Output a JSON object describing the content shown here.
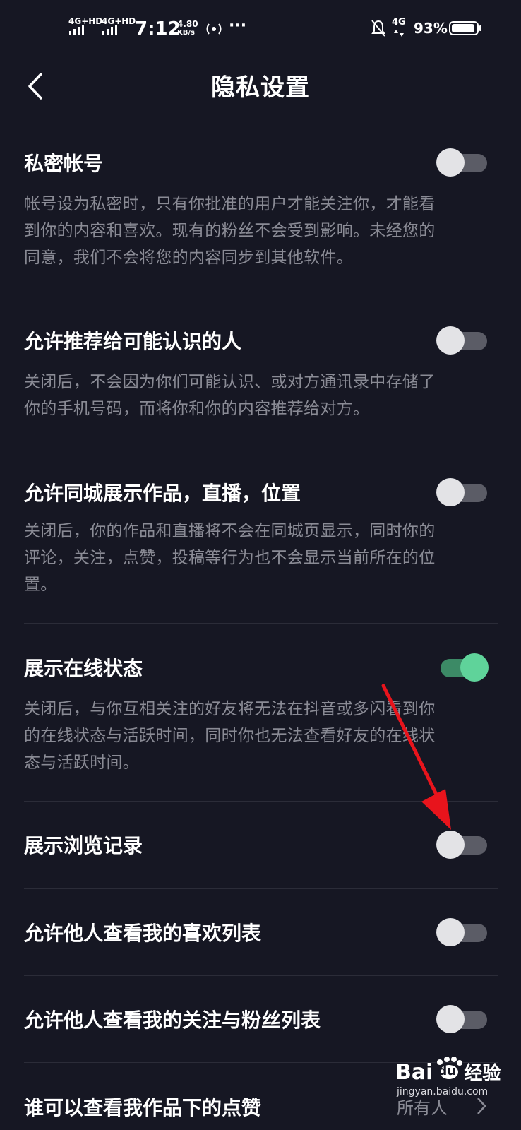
{
  "status_bar": {
    "net1": "4G+HD",
    "net2": "4G+HD",
    "time": "7:12",
    "speed_value": "4.80",
    "speed_unit": "KB/s",
    "dots": "···",
    "net3": "4G",
    "battery": "93%",
    "battery_level": 0.93
  },
  "header": {
    "title": "隐私设置",
    "back_icon": "chevron-left-icon"
  },
  "settings": [
    {
      "title": "私密帐号",
      "desc": [
        "帐号设为私密时，只有你批准的用户才能关注你，才能看",
        "到你的内容和喜欢。现有的粉丝不会受到影响。未经您的",
        "同意，我们不会将您的内容同步到其他软件。"
      ],
      "enabled": false
    },
    {
      "title": "允许推荐给可能认识的人",
      "desc": [
        "关闭后，不会因为你们可能认识、或对方通讯录中存储了",
        "你的手机号码，而将你和你的内容推荐给对方。"
      ],
      "enabled": false
    },
    {
      "title": "允许同城展示作品，直播，位置",
      "desc": [
        "关闭后，你的作品和直播将不会在同城页显示，同时你的",
        "评论，关注，点赞，投稿等行为也不会显示当前所在的位",
        "置。"
      ],
      "enabled": false
    },
    {
      "title": "展示在线状态",
      "desc": [
        "关闭后，与你互相关注的好友将无法在抖音或多闪看到你",
        "的在线状态与活跃时间，同时你也无法查看好友的在线状",
        "态与活跃时间。"
      ],
      "enabled": true
    },
    {
      "title": "展示浏览记录",
      "desc": [],
      "enabled": false
    },
    {
      "title": "允许他人查看我的喜欢列表",
      "desc": [],
      "enabled": false
    },
    {
      "title": "允许他人查看我的关注与粉丝列表",
      "desc": [],
      "enabled": false
    },
    {
      "title": "谁可以查看我作品下的点赞",
      "value": "所有人"
    }
  ],
  "watermark": {
    "brand1": "Bai",
    "brand2": "du",
    "brand3": "经验",
    "url": "jingyan.baidu.com"
  },
  "colors": {
    "background": "#161723",
    "toggle_on": "#5fd39a",
    "toggle_off_knob": "#e3e3e6",
    "annotation_arrow": "#e8141c"
  }
}
